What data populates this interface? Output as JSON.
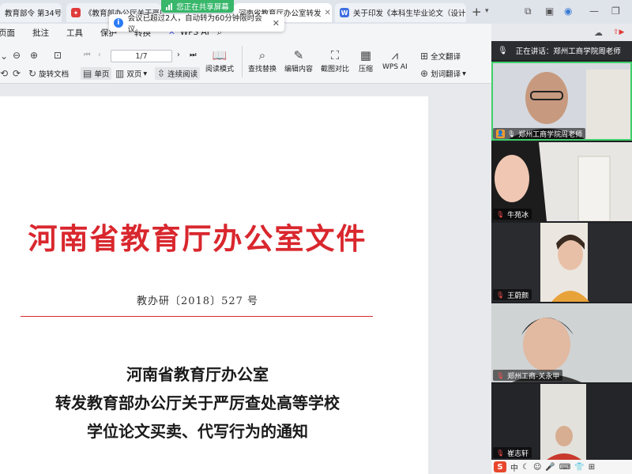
{
  "tabs": [
    {
      "label": "教育部令 第34号",
      "icon_color": "#3a7bd5"
    },
    {
      "label": "《教育部办公厅关于严厉",
      "icon_color": "#e03a3a"
    },
    {
      "label": "河南省教育厅办公室转发",
      "icon_color": "#3a7bd5"
    },
    {
      "label": "关于印发《本科生毕业论文（设计",
      "icon_color": "#3f6fe0",
      "icon_letter": "W"
    }
  ],
  "sharing_banner": "您正在共享屏幕",
  "meeting_notice": "会议已超过2人，自动转为60分钟限时会议。",
  "menu": [
    "页面",
    "批注",
    "工具",
    "保护",
    "转换",
    "WPS AI"
  ],
  "toolbar": {
    "page_indicator": "1/7",
    "rotate": "旋转文档",
    "single_page": "单页",
    "double_page": "双页",
    "continuous": "连续阅读",
    "reading_mode": "阅读模式",
    "find_replace": "查找替换",
    "edit_content": "编辑内容",
    "screenshot_compare": "截图对比",
    "compress": "压缩",
    "wps_ai": "WPS AI",
    "full_translate": "全文翻译",
    "word_translate": "划词翻译"
  },
  "document": {
    "title": "河南省教育厅办公室文件",
    "number": "教办研〔2018〕527 号",
    "notice_lines": [
      "河南省教育厅办公室",
      "转发教育部办公厅关于严厉查处高等学校",
      "学位论文买卖、代写行为的通知"
    ]
  },
  "meeting": {
    "speaking_now": "正在讲话：郑州工商学院周老师",
    "participants": [
      {
        "name": "郑州工商学院周老师",
        "host": true,
        "speaking": true
      },
      {
        "name": "牛苑冰",
        "host": false,
        "speaking": false
      },
      {
        "name": "王蔚颜",
        "host": false,
        "speaking": false
      },
      {
        "name": "郑州工商-关永甲",
        "host": false,
        "speaking": false
      },
      {
        "name": "崔志轩",
        "host": false,
        "speaking": false
      }
    ]
  },
  "ime": {
    "logo": "S",
    "mode": "中"
  },
  "colors": {
    "red_heading": "#d9272e",
    "share_green": "#38b76a",
    "active_speaker": "#3ecf6a"
  }
}
